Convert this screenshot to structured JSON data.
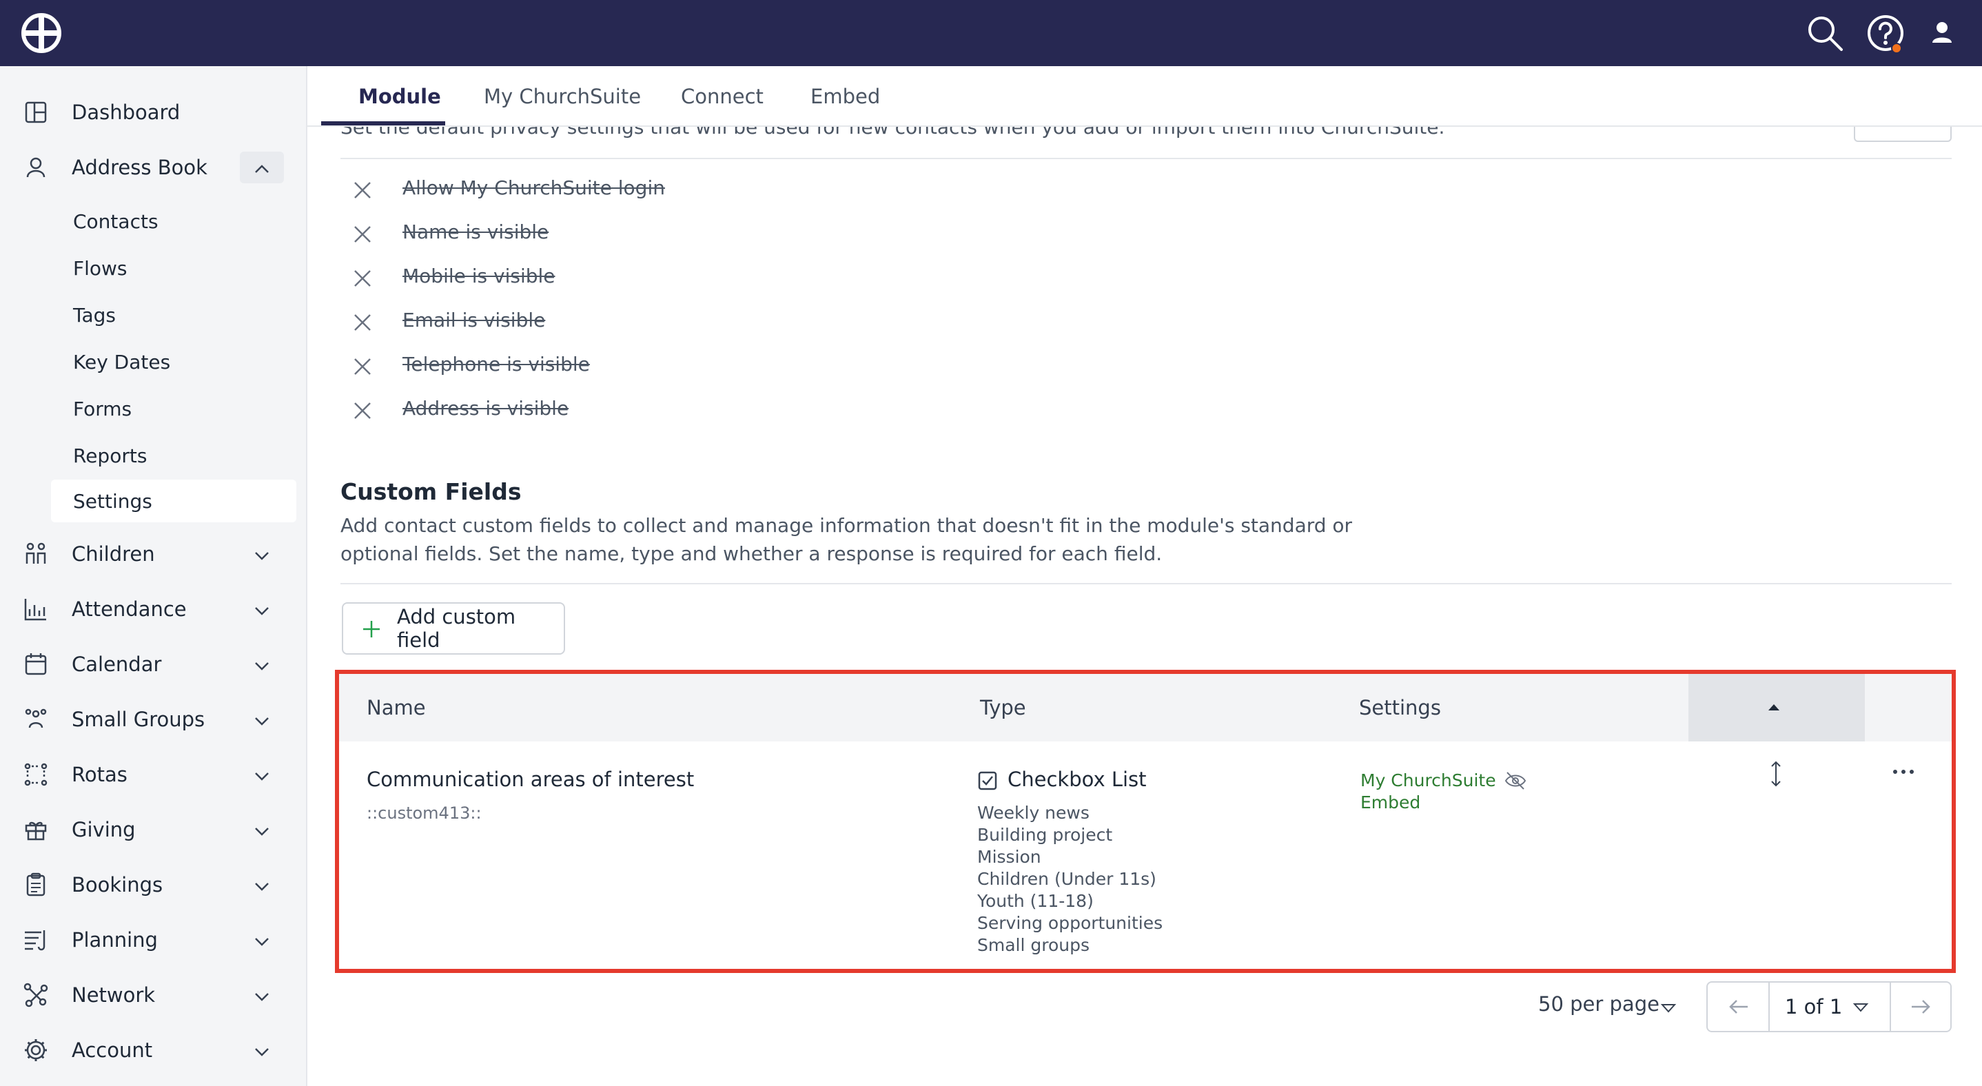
{
  "sidebar": {
    "items": [
      {
        "label": "Dashboard",
        "icon": "dashboard-icon"
      },
      {
        "label": "Address Book",
        "icon": "person-icon"
      },
      {
        "label": "Children",
        "icon": "children-icon"
      },
      {
        "label": "Attendance",
        "icon": "chart-icon"
      },
      {
        "label": "Calendar",
        "icon": "calendar-icon"
      },
      {
        "label": "Small Groups",
        "icon": "group-icon"
      },
      {
        "label": "Rotas",
        "icon": "rotas-icon"
      },
      {
        "label": "Giving",
        "icon": "gift-icon"
      },
      {
        "label": "Bookings",
        "icon": "clipboard-icon"
      },
      {
        "label": "Planning",
        "icon": "planning-icon"
      },
      {
        "label": "Network",
        "icon": "network-icon"
      },
      {
        "label": "Account",
        "icon": "gear-icon"
      }
    ],
    "address_book_sub": [
      "Contacts",
      "Flows",
      "Tags",
      "Key Dates",
      "Forms",
      "Reports",
      "Settings"
    ],
    "active_sub": "Settings"
  },
  "tabs": [
    "Module",
    "My ChurchSuite",
    "Connect",
    "Embed"
  ],
  "active_tab": "Module",
  "privacy": {
    "intro": "Set the default privacy settings that will be used for new contacts when you add or import them into ChurchSuite.",
    "items": [
      "Allow My ChurchSuite login",
      "Name is visible",
      "Mobile is visible",
      "Email is visible",
      "Telephone is visible",
      "Address is visible"
    ]
  },
  "custom_fields": {
    "title": "Custom Fields",
    "description": "Add contact custom fields to collect and manage information that doesn't fit in the module's standard or optional fields. Set the name, type and whether a response is required for each field.",
    "add_button": "Add custom field",
    "columns": [
      "Name",
      "Type",
      "Settings"
    ],
    "rows": [
      {
        "name": "Communication areas of interest",
        "key": "::custom413::",
        "type": "Checkbox List",
        "options": [
          "Weekly news",
          "Building project",
          "Mission",
          "Children (Under 11s)",
          "Youth (11-18)",
          "Serving opportunities",
          "Small groups"
        ],
        "settings": [
          "My ChurchSuite",
          "Embed"
        ]
      }
    ]
  },
  "pagination": {
    "per_page": "50 per page",
    "page": "1 of 1"
  },
  "colors": {
    "topbar": "#272852",
    "highlight": "#e53a2d",
    "settings_green": "#2e7d32",
    "add_plus": "#22a04b",
    "notification": "#f2711c"
  }
}
